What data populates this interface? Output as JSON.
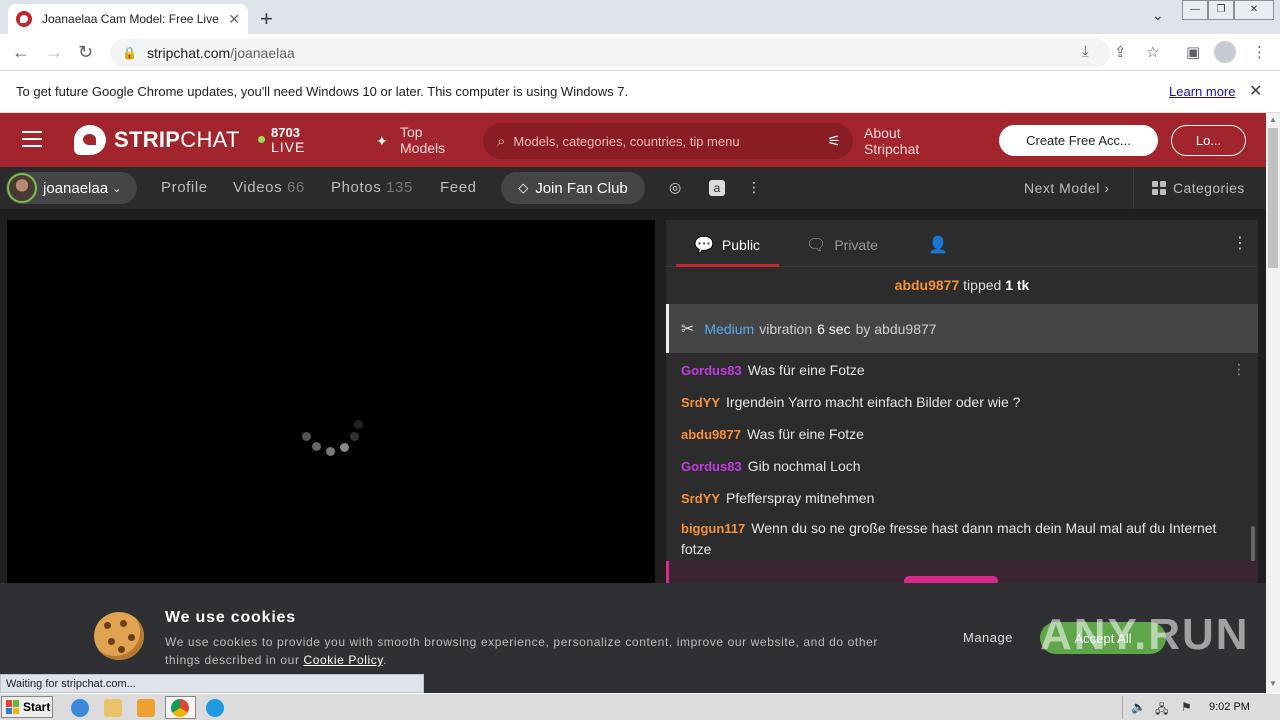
{
  "browser": {
    "tab_title": "Joanaelaa Cam Model: Free Live Sex",
    "url_host": "stripchat.com",
    "url_path": "/joanaelaa",
    "infobar_message": "To get future Google Chrome updates, you'll need Windows 10 or later. This computer is using Windows 7.",
    "infobar_link": "Learn more",
    "status_text": "Waiting for stripchat.com..."
  },
  "header": {
    "logo_bold": "STRIP",
    "logo_thin": "CHAT",
    "live_count": "8703",
    "live_label": "LIVE",
    "top_models_line1": "Top",
    "top_models_line2": "Models",
    "search_placeholder": "Models, categories, countries, tip menu",
    "about_line1": "About",
    "about_line2": "Stripchat",
    "create_account": "Create Free Acc...",
    "login": "Lo..."
  },
  "model_nav": {
    "username": "joanaelaa",
    "profile": "Profile",
    "videos": "Videos",
    "videos_count": "66",
    "photos": "Photos",
    "photos_count": "135",
    "feed": "Feed",
    "fan_club": "Join Fan Club",
    "next_model": "Next Model",
    "categories": "Categories"
  },
  "chat": {
    "tab_public": "Public",
    "tab_private": "Private",
    "tip": {
      "user": "abdu9877",
      "verb": "tipped",
      "amount": "1 tk"
    },
    "vibration": {
      "level": "Medium",
      "word": "vibration",
      "duration": "6 sec",
      "by": "by abdu9877"
    },
    "messages": [
      {
        "user": "Gordus83",
        "color": "purple",
        "text": "Was für eine Fotze"
      },
      {
        "user": "SrdYY",
        "color": "orange",
        "text": "Irgendein Yarro macht einfach Bilder oder wie ?"
      },
      {
        "user": "abdu9877",
        "color": "orange",
        "text": "Was für eine Fotze"
      },
      {
        "user": "Gordus83",
        "color": "purple",
        "text": "Gib nochmal Loch"
      },
      {
        "user": "SrdYY",
        "color": "orange",
        "text": "Pfefferspray mitnehmen"
      },
      {
        "user": "biggun117",
        "color": "orange",
        "text": "Wenn du so ne große fresse hast dann mach dein Maul mal auf du Internet fotze"
      }
    ]
  },
  "cookie": {
    "title": "We use cookies",
    "text": "We use cookies to provide you with smooth browsing experience, personalize content, improve our website, and do other things described in our",
    "policy_link": "Cookie Policy",
    "manage": "Manage",
    "accept": "Accept All"
  },
  "watermark": "ANY.RUN",
  "taskbar": {
    "start": "Start",
    "clock": "9:02 PM"
  },
  "colors": {
    "brand_red": "#a2252d",
    "purple_user": "#c13ee0",
    "orange_user": "#f5913c",
    "vibration_blue": "#5aa8f0",
    "accept_green": "#5fa54a"
  }
}
